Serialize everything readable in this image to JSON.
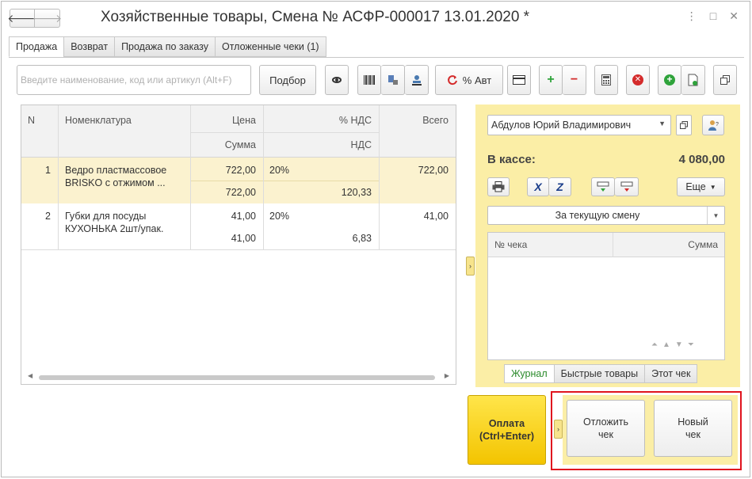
{
  "window": {
    "title": "Хозяйственные товары, Смена № АСФР-000017  13.01.2020 *",
    "back_icon": "arrow-left-icon",
    "forward_icon": "arrow-right-icon",
    "more_glyph": "⋮",
    "maximize_glyph": "□",
    "close_glyph": "✕",
    "back_glyph": "🡐",
    "forward_glyph": "🡒"
  },
  "tabs": [
    {
      "label": "Продажа",
      "active": true
    },
    {
      "label": "Возврат"
    },
    {
      "label": "Продажа по заказу"
    },
    {
      "label": "Отложенные чеки (1)"
    }
  ],
  "toolbar": {
    "search_placeholder": "Введите наименование, код или артикул (Alt+F)",
    "podbor_label": "Подбор",
    "percent_auto_label": "% Авт",
    "plus_glyph": "+",
    "minus_glyph": "−",
    "delete_glyph": "✕",
    "add_glyph": "+"
  },
  "table": {
    "headers": {
      "n": "N",
      "name": "Номенклатура",
      "price": "Цена",
      "vat_pct": "% НДС",
      "total": "Всего",
      "sum": "Сумма",
      "vat": "НДС"
    },
    "rows": [
      {
        "n": "1",
        "name_line1": "Ведро пластмассовое",
        "name_line2": "BRISKO с отжимом ...",
        "price": "722,00",
        "vat_pct": "20%",
        "total": "722,00",
        "sum": "722,00",
        "vat": "120,33"
      },
      {
        "n": "2",
        "name_line1": "Губки для посуды",
        "name_line2": "КУХОНЬКА 2шт/упак.",
        "price": "41,00",
        "vat_pct": "20%",
        "total": "41,00",
        "sum": "41,00",
        "vat": "6,83"
      }
    ]
  },
  "panel": {
    "cashier": "Абдулов Юрий Владимирович",
    "cash_label": "В кассе:",
    "cash_value": "4 080,00",
    "more_label": "Еще",
    "period": "За текущую смену",
    "receipts_grid": {
      "col_number": "№ чека",
      "col_sum": "Сумма"
    },
    "x_glyph": "X",
    "z_glyph": "Z",
    "tabs": [
      {
        "label": "Журнал",
        "active": true
      },
      {
        "label": "Быстрые товары"
      },
      {
        "label": "Этот чек"
      }
    ]
  },
  "bottom": {
    "pay_line1": "Оплата",
    "pay_line2": "(Ctrl+Enter)",
    "postpone_line1": "Отложить",
    "postpone_line2": "чек",
    "new_line1": "Новый",
    "new_line2": "чек"
  },
  "colors": {
    "panel_bg": "#fbeea6",
    "selected_row": "#fbf2cf",
    "pay_button": "#f3c400",
    "highlight_frame": "#e0141e"
  }
}
